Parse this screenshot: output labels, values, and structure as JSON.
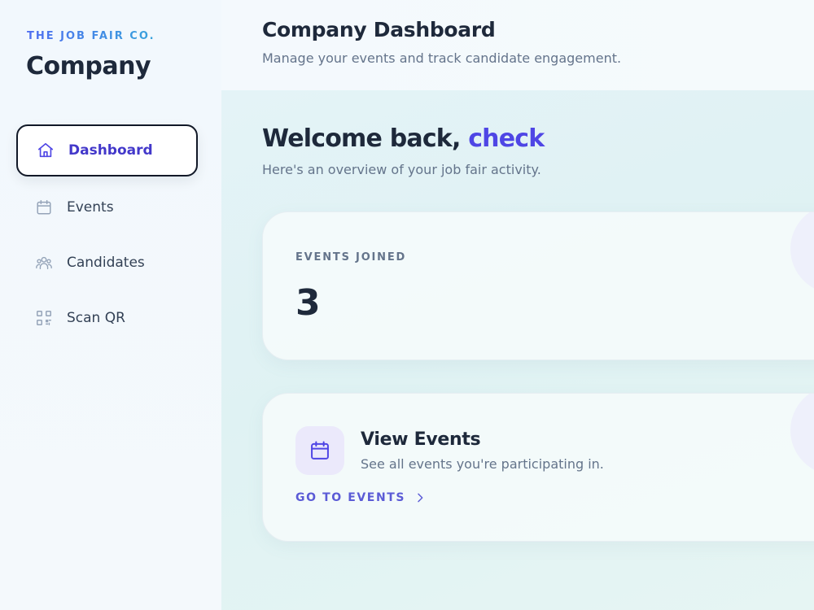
{
  "brand": {
    "tag": "THE JOB FAIR CO.",
    "name": "Company"
  },
  "sidebar": {
    "items": [
      {
        "label": "Dashboard",
        "icon": "home-icon",
        "active": true
      },
      {
        "label": "Events",
        "icon": "calendar-icon",
        "active": false
      },
      {
        "label": "Candidates",
        "icon": "users-icon",
        "active": false
      },
      {
        "label": "Scan QR",
        "icon": "qr-code-icon",
        "active": false
      }
    ]
  },
  "header": {
    "title": "Company Dashboard",
    "subtitle": "Manage your events and track candidate engagement."
  },
  "main": {
    "welcome_prefix": "Welcome back, ",
    "username": "check",
    "welcome_subtitle": "Here's an overview of your job fair activity.",
    "stat": {
      "label": "EVENTS JOINED",
      "value": "3"
    },
    "action": {
      "icon": "calendar-icon",
      "title": "View Events",
      "description": "See all events you're participating in.",
      "link_label": "GO TO EVENTS"
    }
  },
  "colors": {
    "accent": "#4f46e5",
    "text_primary": "#1e293b",
    "text_muted": "#64748b"
  }
}
